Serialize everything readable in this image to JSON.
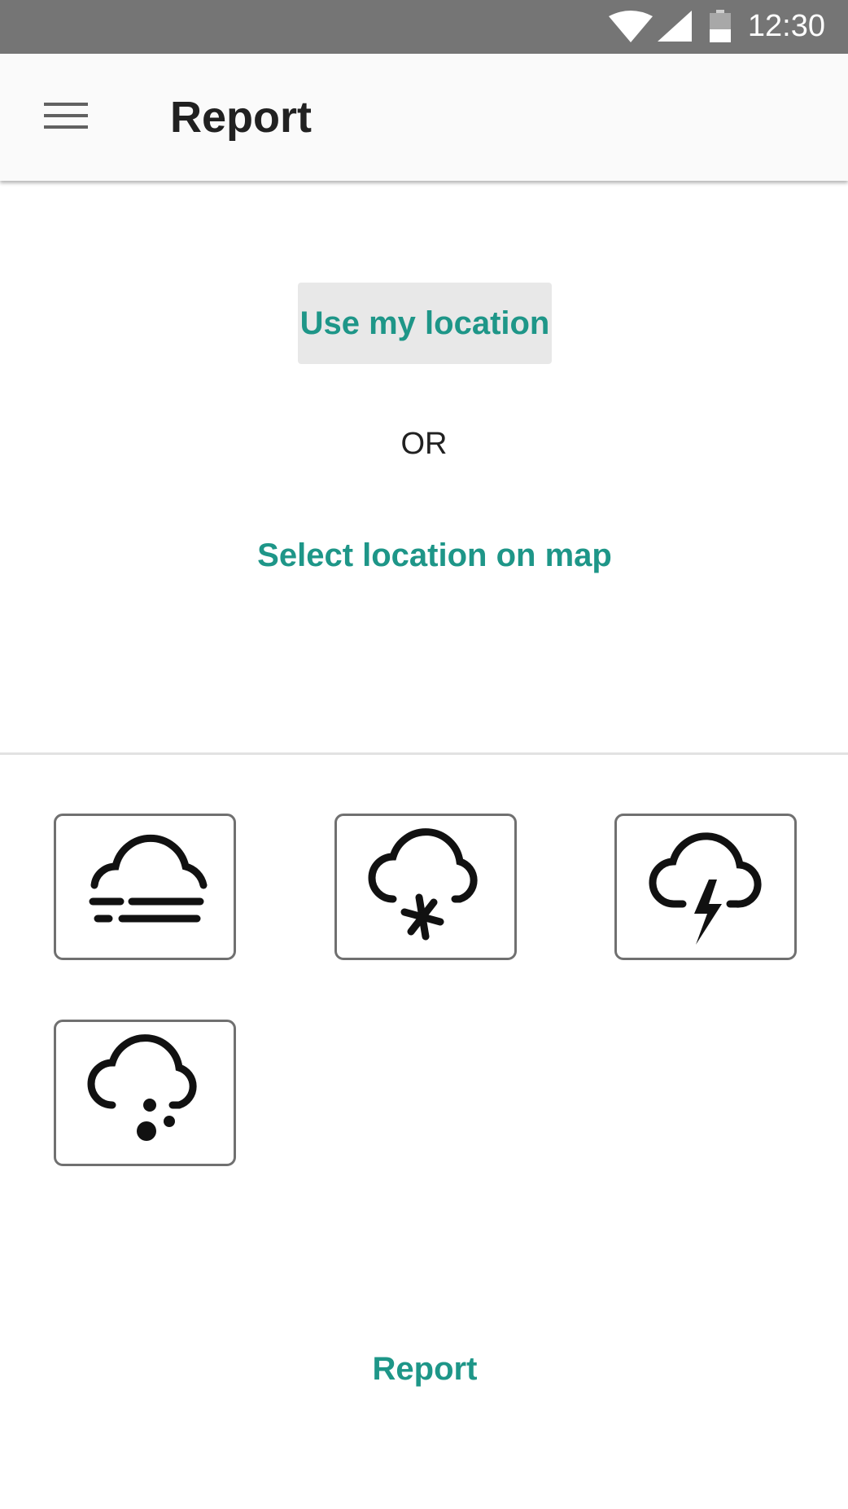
{
  "status_bar": {
    "time": "12:30",
    "icons": [
      "wifi-icon",
      "cell-signal-icon",
      "battery-icon"
    ]
  },
  "app_bar": {
    "menu_icon": "hamburger-menu-icon",
    "title": "Report"
  },
  "location": {
    "use_my_location_label": "Use my location",
    "or_label": "OR",
    "select_on_map_label": "Select location on map"
  },
  "weather_options": [
    {
      "icon": "fog-icon"
    },
    {
      "icon": "snow-icon"
    },
    {
      "icon": "thunderstorm-icon"
    },
    {
      "icon": "hail-icon"
    }
  ],
  "actions": {
    "report_label": "Report"
  },
  "colors": {
    "accent": "#1e9688",
    "status_bar": "#757575",
    "app_bar": "#fafafa",
    "button_bg": "#e8e8e8",
    "tile_border": "#707070"
  }
}
